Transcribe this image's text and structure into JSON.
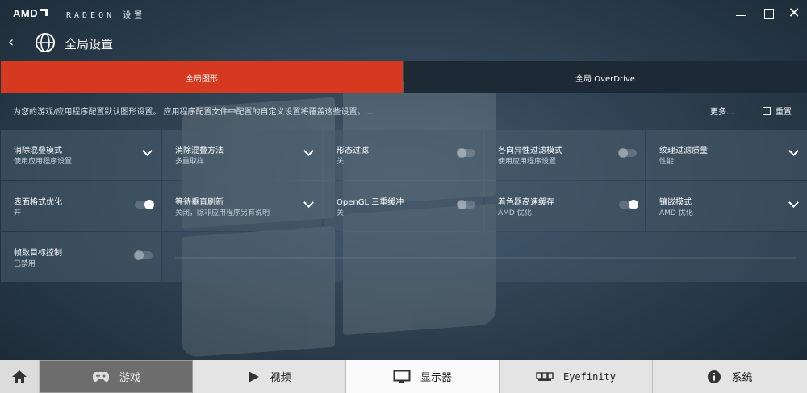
{
  "app": {
    "logo": "AMD",
    "name": "RADEON 设置"
  },
  "header": {
    "title": "全局设置"
  },
  "tabs": [
    {
      "label": "全局图形",
      "active": true
    },
    {
      "label": "全局 OverDrive",
      "active": false
    }
  ],
  "description": "为您的游戏/应用程序配置默认图形设置。 应用程序配置文件中配置的自定义设置将覆盖这些设置。...",
  "actions": {
    "more": "更多...",
    "reset": "重置"
  },
  "settings": [
    {
      "title": "消除混叠模式",
      "value": "使用应用程序设置",
      "control": "dropdown"
    },
    {
      "title": "消除混叠方法",
      "value": "多重取样",
      "control": "dropdown"
    },
    {
      "title": "形态过滤",
      "value": "关",
      "control": "toggle",
      "on": false
    },
    {
      "title": "各向异性过滤模式",
      "value": "使用应用程序设置",
      "control": "toggle",
      "on": false
    },
    {
      "title": "纹理过滤质量",
      "value": "性能",
      "control": "dropdown"
    },
    {
      "title": "表面格式优化",
      "value": "开",
      "control": "toggle",
      "on": true
    },
    {
      "title": "等待垂直刷新",
      "value": "关闭，除非应用程序另有说明",
      "control": "dropdown"
    },
    {
      "title": "OpenGL 三重缓冲",
      "value": "关",
      "control": "toggle",
      "on": false
    },
    {
      "title": "着色器高速缓存",
      "value": "AMD 优化",
      "control": "toggle",
      "on": true
    },
    {
      "title": "镶嵌模式",
      "value": "AMD 优化",
      "control": "dropdown"
    },
    {
      "title": "帧数目标控制",
      "value": "已禁用",
      "control": "toggle",
      "on": false
    }
  ],
  "bottom_nav": [
    {
      "label": "",
      "icon": "home-icon"
    },
    {
      "label": "游戏",
      "icon": "gamepad-icon",
      "active": true
    },
    {
      "label": "视频",
      "icon": "play-icon"
    },
    {
      "label": "显示器",
      "icon": "monitor-icon"
    },
    {
      "label": "Eyefinity",
      "icon": "eyefinity-icon"
    },
    {
      "label": "系统",
      "icon": "info-icon"
    }
  ],
  "colors": {
    "accent": "#d53a20",
    "tab_inactive": "#1d2935",
    "background": "#2f4253"
  }
}
